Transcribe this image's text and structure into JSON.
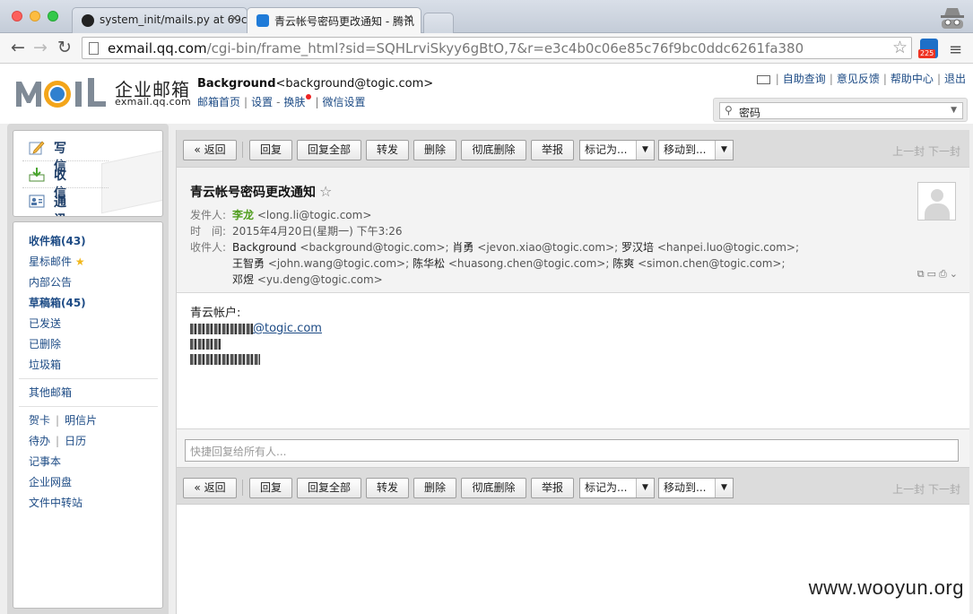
{
  "browser": {
    "tabs": [
      {
        "title": "system_init/mails.py at 69c",
        "active": false
      },
      {
        "title": "青云帐号密码更改通知 - 腾讯",
        "active": true
      }
    ],
    "url_host": "exmail.qq.com",
    "url_path": "/cgi-bin/frame_html?sid=SQHLrviSkyy6gBtO,7&r=e3c4b0c06e85c76f9bc0ddc6261fa380",
    "extension_badge": "225"
  },
  "header": {
    "logo_text": "MOil",
    "product_name": "企业邮箱",
    "product_domain": "exmail.qq.com",
    "account_name": "Background",
    "account_email": "<background@togic.com>",
    "links": [
      "邮箱首页",
      "设置",
      "换肤",
      "微信设置"
    ],
    "top_links": [
      "自助查询",
      "意见反馈",
      "帮助中心",
      "退出"
    ],
    "search_value": "密码"
  },
  "sidebar": {
    "quick": [
      "写信",
      "收信",
      "通讯录"
    ],
    "folders": [
      {
        "label": "收件箱(43)",
        "bold": true
      },
      {
        "label": "星标邮件"
      },
      {
        "label": "内部公告"
      },
      {
        "label": "草稿箱(45)",
        "bold": true
      },
      {
        "label": "已发送"
      },
      {
        "label": "已删除"
      },
      {
        "label": "垃圾箱"
      }
    ],
    "other_mailbox": "其他邮箱",
    "tools": {
      "card": "贺卡",
      "postcard": "明信片",
      "todo": "待办",
      "calendar": "日历",
      "notes": "记事本",
      "disk": "企业网盘",
      "transfer": "文件中转站"
    }
  },
  "toolbar": {
    "back": "« 返回",
    "reply": "回复",
    "reply_all": "回复全部",
    "forward": "转发",
    "delete": "删除",
    "delete_perm": "彻底删除",
    "report": "举报",
    "mark_as": "标记为...",
    "move_to": "移动到...",
    "prev": "上一封",
    "next": "下一封"
  },
  "mail": {
    "subject": "青云帐号密码更改通知",
    "from_label": "发件人:",
    "from_name": "李龙",
    "from_addr": "<long.li@togic.com>",
    "time_label": "时　间:",
    "time": "2015年4月20日(星期一) 下午3:26",
    "to_label": "收件人:",
    "to_line1": [
      {
        "name": "Background",
        "addr": "<background@togic.com>;"
      },
      {
        "name": "肖勇",
        "addr": "<jevon.xiao@togic.com>;"
      },
      {
        "name": "罗汉培",
        "addr": "<hanpei.luo@togic.com>;"
      }
    ],
    "to_line2": [
      {
        "name": "王智勇",
        "addr": "<john.wang@togic.com>;"
      },
      {
        "name": "陈华松",
        "addr": "<huasong.chen@togic.com>;"
      },
      {
        "name": "陈爽",
        "addr": "<simon.chen@togic.com>;"
      }
    ],
    "to_line3": [
      {
        "name": "邓煜",
        "addr": "<yu.deng@togic.com>"
      }
    ],
    "body_greeting": "青云帐户:",
    "body_domain": "@togic.com"
  },
  "reply": {
    "placeholder": "快捷回复给所有人..."
  },
  "watermark": "www.wooyun.org"
}
